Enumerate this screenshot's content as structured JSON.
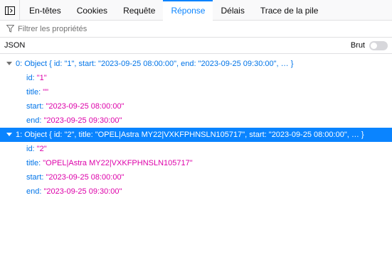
{
  "tabs": [
    {
      "label": "En-têtes",
      "selected": false
    },
    {
      "label": "Cookies",
      "selected": false
    },
    {
      "label": "Requête",
      "selected": false
    },
    {
      "label": "Réponse",
      "selected": true
    },
    {
      "label": "Délais",
      "selected": false
    },
    {
      "label": "Trace de la pile",
      "selected": false
    }
  ],
  "icons": {
    "pane_toggle": "toggle-pane-icon",
    "filter": "filter-icon",
    "expanded": "chevron-down-icon"
  },
  "filter": {
    "placeholder": "Filtrer les propriétés",
    "value": ""
  },
  "json_bar": {
    "title": "JSON",
    "raw_label": "Brut",
    "raw_enabled": false
  },
  "tree": {
    "rows": [
      {
        "index": "0:",
        "summary": "Object { id: \"1\", start: \"2023-09-25 08:00:00\", end: \"2023-09-25 09:30:00\", … }",
        "selected": false
      },
      {
        "index": "1:",
        "summary": "Object { id: \"2\", title: \"OPEL|Astra MY22|VXKFPHNSLN105717\", start: \"2023-09-25 08:00:00\", … }",
        "selected": true
      }
    ],
    "children_0": [
      {
        "key": "id:",
        "value": "\"1\""
      },
      {
        "key": "title:",
        "value": "\"\""
      },
      {
        "key": "start:",
        "value": "\"2023-09-25 08:00:00\""
      },
      {
        "key": "end:",
        "value": "\"2023-09-25 09:30:00\""
      }
    ],
    "children_1": [
      {
        "key": "id:",
        "value": "\"2\""
      },
      {
        "key": "title:",
        "value": "\"OPEL|Astra MY22|VXKFPHNSLN105717\""
      },
      {
        "key": "start:",
        "value": "\"2023-09-25 08:00:00\""
      },
      {
        "key": "end:",
        "value": "\"2023-09-25 09:30:00\""
      }
    ]
  },
  "colors": {
    "accent": "#0a84ff",
    "key": "#0074e8",
    "string": "#dd00a9",
    "selected_row_bg": "#0a84ff"
  }
}
